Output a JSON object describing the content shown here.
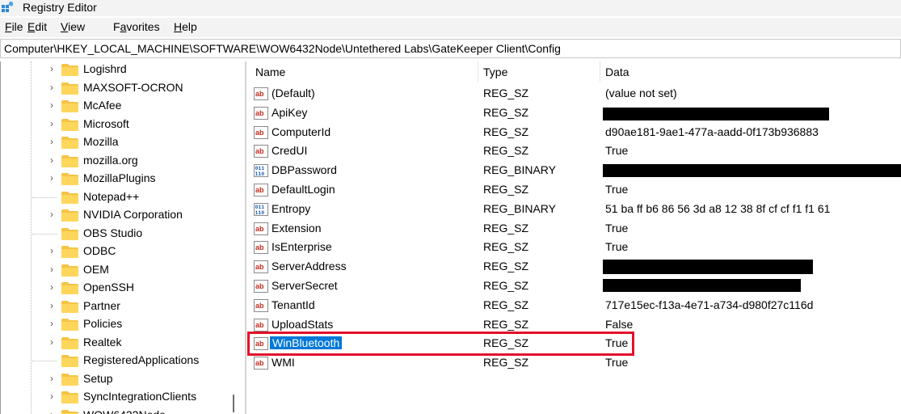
{
  "window": {
    "title": "Registry Editor"
  },
  "menu": [
    {
      "underline": "F",
      "rest": "ile"
    },
    {
      "underline": "E",
      "rest": "dit"
    },
    {
      "underline": "V",
      "rest": "iew"
    },
    {
      "pre": "F",
      "underline": "a",
      "rest": "vorites"
    },
    {
      "underline": "H",
      "rest": "elp"
    }
  ],
  "address": "Computer\\HKEY_LOCAL_MACHINE\\SOFTWARE\\WOW6432Node\\Untethered Labs\\GateKeeper Client\\Config",
  "tree": [
    {
      "label": "Logishrd",
      "expandable": true
    },
    {
      "label": "MAXSOFT-OCRON",
      "expandable": true
    },
    {
      "label": "McAfee",
      "expandable": true
    },
    {
      "label": "Microsoft",
      "expandable": true
    },
    {
      "label": "Mozilla",
      "expandable": true
    },
    {
      "label": "mozilla.org",
      "expandable": true
    },
    {
      "label": "MozillaPlugins",
      "expandable": true
    },
    {
      "label": "Notepad++",
      "expandable": false
    },
    {
      "label": "NVIDIA Corporation",
      "expandable": true
    },
    {
      "label": "OBS Studio",
      "expandable": false
    },
    {
      "label": "ODBC",
      "expandable": true
    },
    {
      "label": "OEM",
      "expandable": true
    },
    {
      "label": "OpenSSH",
      "expandable": true
    },
    {
      "label": "Partner",
      "expandable": true
    },
    {
      "label": "Policies",
      "expandable": true
    },
    {
      "label": "Realtek",
      "expandable": true
    },
    {
      "label": "RegisteredApplications",
      "expandable": false
    },
    {
      "label": "Setup",
      "expandable": true
    },
    {
      "label": "SyncIntegrationClients",
      "expandable": true
    },
    {
      "label": "WOW6432Node",
      "expandable": true
    }
  ],
  "columns": {
    "name": "Name",
    "type": "Type",
    "data": "Data"
  },
  "values": [
    {
      "name": "(Default)",
      "type": "REG_SZ",
      "data": "(value not set)",
      "icon": "string-value-icon"
    },
    {
      "name": "ApiKey",
      "type": "REG_SZ",
      "data": "",
      "redacted": true,
      "icon": "string-value-icon"
    },
    {
      "name": "ComputerId",
      "type": "REG_SZ",
      "data": "d90ae181-9ae1-477a-aadd-0f173b936883",
      "icon": "string-value-icon"
    },
    {
      "name": "CredUI",
      "type": "REG_SZ",
      "data": "True",
      "icon": "string-value-icon"
    },
    {
      "name": "DBPassword",
      "type": "REG_BINARY",
      "data": "",
      "redacted": true,
      "icon": "binary-value-icon"
    },
    {
      "name": "DefaultLogin",
      "type": "REG_SZ",
      "data": "True",
      "icon": "string-value-icon"
    },
    {
      "name": "Entropy",
      "type": "REG_BINARY",
      "data": "51 ba ff b6 86 56 3d a8 12 38 8f cf cf f1 f1 61",
      "icon": "binary-value-icon"
    },
    {
      "name": "Extension",
      "type": "REG_SZ",
      "data": "True",
      "icon": "string-value-icon"
    },
    {
      "name": "IsEnterprise",
      "type": "REG_SZ",
      "data": "True",
      "icon": "string-value-icon"
    },
    {
      "name": "ServerAddress",
      "type": "REG_SZ",
      "data": "",
      "redacted": true,
      "icon": "string-value-icon"
    },
    {
      "name": "ServerSecret",
      "type": "REG_SZ",
      "data": "",
      "redacted": true,
      "icon": "string-value-icon"
    },
    {
      "name": "TenantId",
      "type": "REG_SZ",
      "data": "717e15ec-f13a-4e71-a734-d980f27c116d",
      "icon": "string-value-icon"
    },
    {
      "name": "UploadStats",
      "type": "REG_SZ",
      "data": "False",
      "icon": "string-value-icon"
    },
    {
      "name": "WinBluetooth",
      "type": "REG_SZ",
      "data": "True",
      "selected": true,
      "highlighted": true,
      "icon": "string-value-icon"
    },
    {
      "name": "WMI",
      "type": "REG_SZ",
      "data": "True",
      "icon": "string-value-icon"
    }
  ],
  "colors": {
    "selection": "#0078d7",
    "highlight_box": "#e3102b",
    "folder": "#f5c445"
  }
}
